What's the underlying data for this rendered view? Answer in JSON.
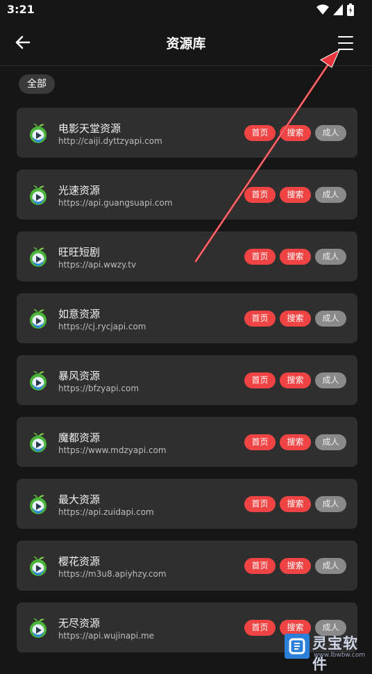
{
  "status": {
    "time": "3:21"
  },
  "header": {
    "title": "资源库"
  },
  "filter": {
    "chip": "全部"
  },
  "sources": [
    {
      "name": "电影天堂资源",
      "url": "http://caiji.dyttzyapi.com"
    },
    {
      "name": "光速资源",
      "url": "https://api.guangsuapi.com"
    },
    {
      "name": "旺旺短剧",
      "url": "https://api.wwzy.tv"
    },
    {
      "name": "如意资源",
      "url": "https://cj.rycjapi.com"
    },
    {
      "name": "暴风资源",
      "url": "https://bfzyapi.com"
    },
    {
      "name": "魔都资源",
      "url": "https://www.mdzyapi.com"
    },
    {
      "name": "最大资源",
      "url": "https://api.zuidapi.com"
    },
    {
      "name": "樱花资源",
      "url": "https://m3u8.apiyhzy.com"
    },
    {
      "name": "无尽资源",
      "url": "https://api.wujinapi.me"
    }
  ],
  "tags": {
    "home": "首页",
    "search": "搜索",
    "adult": "成人"
  },
  "watermark": {
    "brand": "灵宝软件",
    "site": "www.lbwbw.com"
  },
  "colors": {
    "accent_red": "#f04444",
    "tag_grey": "#8a8a8a",
    "card_bg": "#2f2f2f",
    "bg": "#161616"
  }
}
